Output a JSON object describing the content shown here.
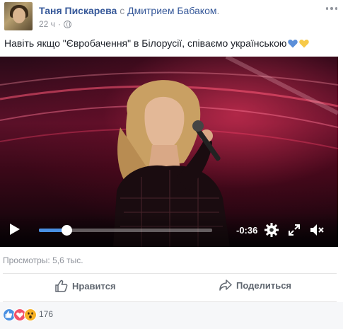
{
  "post": {
    "author": "Таня Пискарева",
    "with_word": "с",
    "tagged": "Дмитрием Бабаком",
    "tagged_suffix": ".",
    "time": "22 ч",
    "dot": "·",
    "text": "Навіть якщо \"Євробачення\" в Білорусії, співаємо українською",
    "heart_colors": {
      "blue": "#5b8fd9",
      "yellow": "#f7c948"
    }
  },
  "video": {
    "time_remaining": "-0:36",
    "progress_fraction": 0.16,
    "accent": "#4a90e2",
    "icons": {
      "play": "play-icon",
      "settings": "gear-icon",
      "fullscreen": "expand-icon",
      "volume": "mute-icon"
    }
  },
  "stats": {
    "views": "Просмотры: 5,6 тыс."
  },
  "actions": {
    "like_label": "Нравится",
    "share_label": "Поделиться"
  },
  "reactions": {
    "types": [
      "like",
      "love",
      "wow"
    ],
    "count": "176"
  },
  "colors": {
    "link": "#365899",
    "meta": "#90949c",
    "text": "#1d2129"
  }
}
